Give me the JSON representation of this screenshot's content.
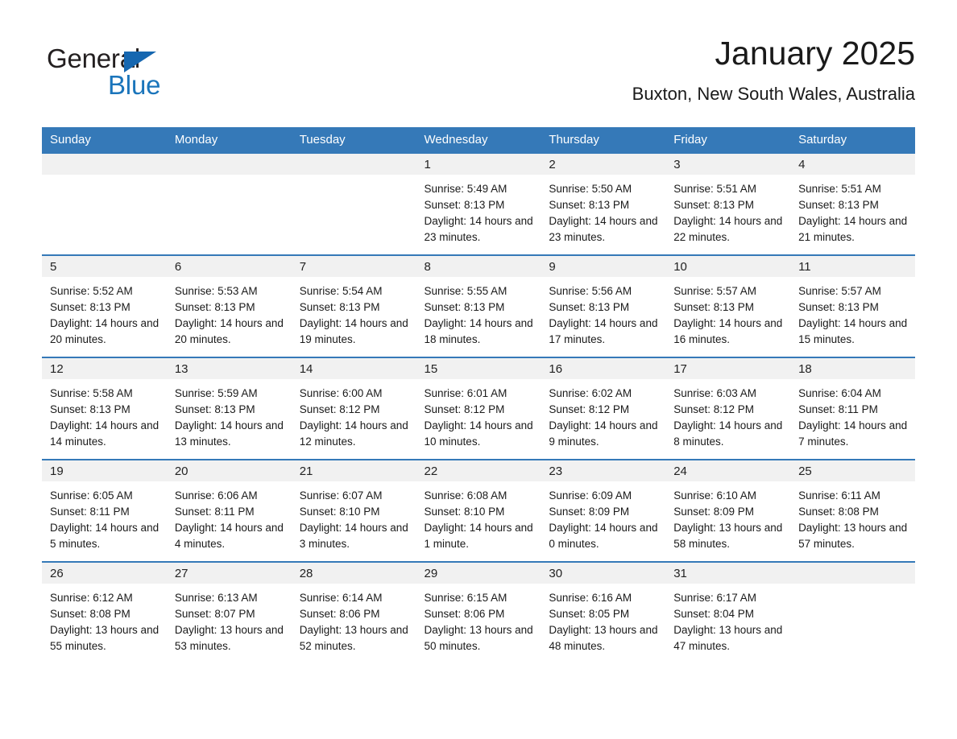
{
  "brand": {
    "name_part1": "General",
    "name_part2": "Blue"
  },
  "header": {
    "title": "January 2025",
    "location": "Buxton, New South Wales, Australia"
  },
  "weekday_headers": [
    "Sunday",
    "Monday",
    "Tuesday",
    "Wednesday",
    "Thursday",
    "Friday",
    "Saturday"
  ],
  "colors": {
    "header_blue": "#3579b8",
    "daynum_band": "#f1f1f1",
    "brand_blue": "#1b75bb",
    "text": "#1a1a1a"
  },
  "weeks": [
    [
      {
        "day": "",
        "sunrise": "",
        "sunset": "",
        "daylight": "",
        "empty": true
      },
      {
        "day": "",
        "sunrise": "",
        "sunset": "",
        "daylight": "",
        "empty": true
      },
      {
        "day": "",
        "sunrise": "",
        "sunset": "",
        "daylight": "",
        "empty": true
      },
      {
        "day": "1",
        "sunrise": "Sunrise: 5:49 AM",
        "sunset": "Sunset: 8:13 PM",
        "daylight": "Daylight: 14 hours and 23 minutes."
      },
      {
        "day": "2",
        "sunrise": "Sunrise: 5:50 AM",
        "sunset": "Sunset: 8:13 PM",
        "daylight": "Daylight: 14 hours and 23 minutes."
      },
      {
        "day": "3",
        "sunrise": "Sunrise: 5:51 AM",
        "sunset": "Sunset: 8:13 PM",
        "daylight": "Daylight: 14 hours and 22 minutes."
      },
      {
        "day": "4",
        "sunrise": "Sunrise: 5:51 AM",
        "sunset": "Sunset: 8:13 PM",
        "daylight": "Daylight: 14 hours and 21 minutes."
      }
    ],
    [
      {
        "day": "5",
        "sunrise": "Sunrise: 5:52 AM",
        "sunset": "Sunset: 8:13 PM",
        "daylight": "Daylight: 14 hours and 20 minutes."
      },
      {
        "day": "6",
        "sunrise": "Sunrise: 5:53 AM",
        "sunset": "Sunset: 8:13 PM",
        "daylight": "Daylight: 14 hours and 20 minutes."
      },
      {
        "day": "7",
        "sunrise": "Sunrise: 5:54 AM",
        "sunset": "Sunset: 8:13 PM",
        "daylight": "Daylight: 14 hours and 19 minutes."
      },
      {
        "day": "8",
        "sunrise": "Sunrise: 5:55 AM",
        "sunset": "Sunset: 8:13 PM",
        "daylight": "Daylight: 14 hours and 18 minutes."
      },
      {
        "day": "9",
        "sunrise": "Sunrise: 5:56 AM",
        "sunset": "Sunset: 8:13 PM",
        "daylight": "Daylight: 14 hours and 17 minutes."
      },
      {
        "day": "10",
        "sunrise": "Sunrise: 5:57 AM",
        "sunset": "Sunset: 8:13 PM",
        "daylight": "Daylight: 14 hours and 16 minutes."
      },
      {
        "day": "11",
        "sunrise": "Sunrise: 5:57 AM",
        "sunset": "Sunset: 8:13 PM",
        "daylight": "Daylight: 14 hours and 15 minutes."
      }
    ],
    [
      {
        "day": "12",
        "sunrise": "Sunrise: 5:58 AM",
        "sunset": "Sunset: 8:13 PM",
        "daylight": "Daylight: 14 hours and 14 minutes."
      },
      {
        "day": "13",
        "sunrise": "Sunrise: 5:59 AM",
        "sunset": "Sunset: 8:13 PM",
        "daylight": "Daylight: 14 hours and 13 minutes."
      },
      {
        "day": "14",
        "sunrise": "Sunrise: 6:00 AM",
        "sunset": "Sunset: 8:12 PM",
        "daylight": "Daylight: 14 hours and 12 minutes."
      },
      {
        "day": "15",
        "sunrise": "Sunrise: 6:01 AM",
        "sunset": "Sunset: 8:12 PM",
        "daylight": "Daylight: 14 hours and 10 minutes."
      },
      {
        "day": "16",
        "sunrise": "Sunrise: 6:02 AM",
        "sunset": "Sunset: 8:12 PM",
        "daylight": "Daylight: 14 hours and 9 minutes."
      },
      {
        "day": "17",
        "sunrise": "Sunrise: 6:03 AM",
        "sunset": "Sunset: 8:12 PM",
        "daylight": "Daylight: 14 hours and 8 minutes."
      },
      {
        "day": "18",
        "sunrise": "Sunrise: 6:04 AM",
        "sunset": "Sunset: 8:11 PM",
        "daylight": "Daylight: 14 hours and 7 minutes."
      }
    ],
    [
      {
        "day": "19",
        "sunrise": "Sunrise: 6:05 AM",
        "sunset": "Sunset: 8:11 PM",
        "daylight": "Daylight: 14 hours and 5 minutes."
      },
      {
        "day": "20",
        "sunrise": "Sunrise: 6:06 AM",
        "sunset": "Sunset: 8:11 PM",
        "daylight": "Daylight: 14 hours and 4 minutes."
      },
      {
        "day": "21",
        "sunrise": "Sunrise: 6:07 AM",
        "sunset": "Sunset: 8:10 PM",
        "daylight": "Daylight: 14 hours and 3 minutes."
      },
      {
        "day": "22",
        "sunrise": "Sunrise: 6:08 AM",
        "sunset": "Sunset: 8:10 PM",
        "daylight": "Daylight: 14 hours and 1 minute."
      },
      {
        "day": "23",
        "sunrise": "Sunrise: 6:09 AM",
        "sunset": "Sunset: 8:09 PM",
        "daylight": "Daylight: 14 hours and 0 minutes."
      },
      {
        "day": "24",
        "sunrise": "Sunrise: 6:10 AM",
        "sunset": "Sunset: 8:09 PM",
        "daylight": "Daylight: 13 hours and 58 minutes."
      },
      {
        "day": "25",
        "sunrise": "Sunrise: 6:11 AM",
        "sunset": "Sunset: 8:08 PM",
        "daylight": "Daylight: 13 hours and 57 minutes."
      }
    ],
    [
      {
        "day": "26",
        "sunrise": "Sunrise: 6:12 AM",
        "sunset": "Sunset: 8:08 PM",
        "daylight": "Daylight: 13 hours and 55 minutes."
      },
      {
        "day": "27",
        "sunrise": "Sunrise: 6:13 AM",
        "sunset": "Sunset: 8:07 PM",
        "daylight": "Daylight: 13 hours and 53 minutes."
      },
      {
        "day": "28",
        "sunrise": "Sunrise: 6:14 AM",
        "sunset": "Sunset: 8:06 PM",
        "daylight": "Daylight: 13 hours and 52 minutes."
      },
      {
        "day": "29",
        "sunrise": "Sunrise: 6:15 AM",
        "sunset": "Sunset: 8:06 PM",
        "daylight": "Daylight: 13 hours and 50 minutes."
      },
      {
        "day": "30",
        "sunrise": "Sunrise: 6:16 AM",
        "sunset": "Sunset: 8:05 PM",
        "daylight": "Daylight: 13 hours and 48 minutes."
      },
      {
        "day": "31",
        "sunrise": "Sunrise: 6:17 AM",
        "sunset": "Sunset: 8:04 PM",
        "daylight": "Daylight: 13 hours and 47 minutes."
      },
      {
        "day": "",
        "sunrise": "",
        "sunset": "",
        "daylight": "",
        "empty": true
      }
    ]
  ]
}
